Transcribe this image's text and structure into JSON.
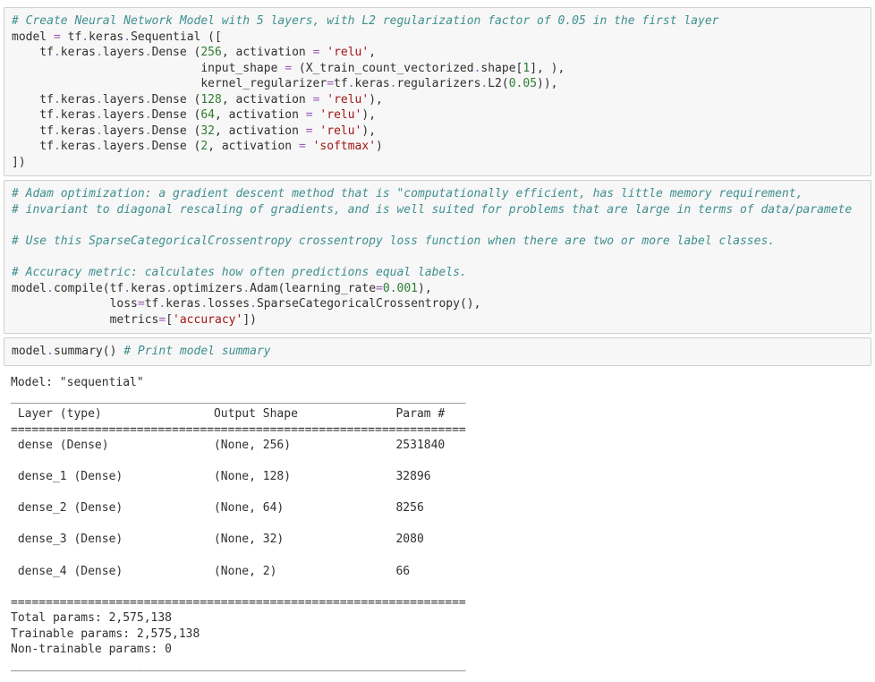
{
  "cell1": {
    "comment": "# Create Neural Network Model with 5 layers, with L2 regularization factor of 0.05 in the first layer",
    "l1a": "model ",
    "l1eq": "=",
    "l1b": " tf",
    "l1dot": ".",
    "l1c": "keras",
    "l1d": "Sequential ([",
    "l2a": "    tf",
    "l2b": "keras",
    "l2c": "layers",
    "l2d": "Dense (",
    "l2n": "256",
    "l2e": ", activation ",
    "l2eq": "=",
    "l2sp": " ",
    "l2s": "'relu'",
    "l2f": ",",
    "l3a": "                           input_shape ",
    "l3eq": "=",
    "l3b": " (X_train_count_vectorized",
    "l3c": "shape[",
    "l3n": "1",
    "l3d": "], ),",
    "l4a": "                           kernel_regularizer",
    "l4eq": "=",
    "l4b": "tf",
    "l4c": "keras",
    "l4d": "regularizers",
    "l4e": "L2(",
    "l4n": "0.05",
    "l4f": ")),",
    "l5a": "    tf",
    "l5b": "keras",
    "l5c": "layers",
    "l5d": "Dense (",
    "l5n": "128",
    "l5e": ", activation ",
    "l5s": "'relu'",
    "l5f": "),",
    "l6n": "64",
    "l7n": "32",
    "l8a": "    tf",
    "l8b": "keras",
    "l8c": "layers",
    "l8d": "Dense (",
    "l8n": "2",
    "l8e": ", activation ",
    "l8s": "'softmax'",
    "l8f": ")",
    "l9": "])"
  },
  "cell2": {
    "c1": "# Adam optimization: a gradient descent method that is \"computationally efficient, has little memory requirement,",
    "c2": "# invariant to diagonal rescaling of gradients, and is well suited for problems that are large in terms of data/paramete",
    "c3": "# Use this SparseCategoricalCrossentropy crossentropy loss function when there are two or more label classes.",
    "c4": "# Accuracy metric: calculates how often predictions equal labels.",
    "l1a": "model",
    "l1b": "compile(tf",
    "l1c": "keras",
    "l1d": "optimizers",
    "l1e": "Adam(learning_rate",
    "l1eq": "=",
    "l1n": "0.001",
    "l1f": "),",
    "l2a": "              loss",
    "l2eq": "=",
    "l2b": "tf",
    "l2c": "keras",
    "l2d": "losses",
    "l2e": "SparseCategoricalCrossentropy(),",
    "l3a": "              metrics",
    "l3eq": "=",
    "l3b": "[",
    "l3s": "'accuracy'",
    "l3c": "])"
  },
  "cell3": {
    "l1a": "model",
    "l1b": "summary() ",
    "l1c": "# Print model summary"
  },
  "output": {
    "header": "Model: \"sequential\"",
    "sep_thin": "_________________________________________________________________",
    "colhead": " Layer (type)                Output Shape              Param #   ",
    "sep_thick": "=================================================================",
    "r1": " dense (Dense)               (None, 256)               2531840   ",
    "r2": " dense_1 (Dense)             (None, 128)               32896     ",
    "r3": " dense_2 (Dense)             (None, 64)                8256      ",
    "r4": " dense_3 (Dense)             (None, 32)                2080      ",
    "r5": " dense_4 (Dense)             (None, 2)                 66        ",
    "t1": "Total params: 2,575,138",
    "t2": "Trainable params: 2,575,138",
    "t3": "Non-trainable params: 0"
  },
  "dot": "."
}
